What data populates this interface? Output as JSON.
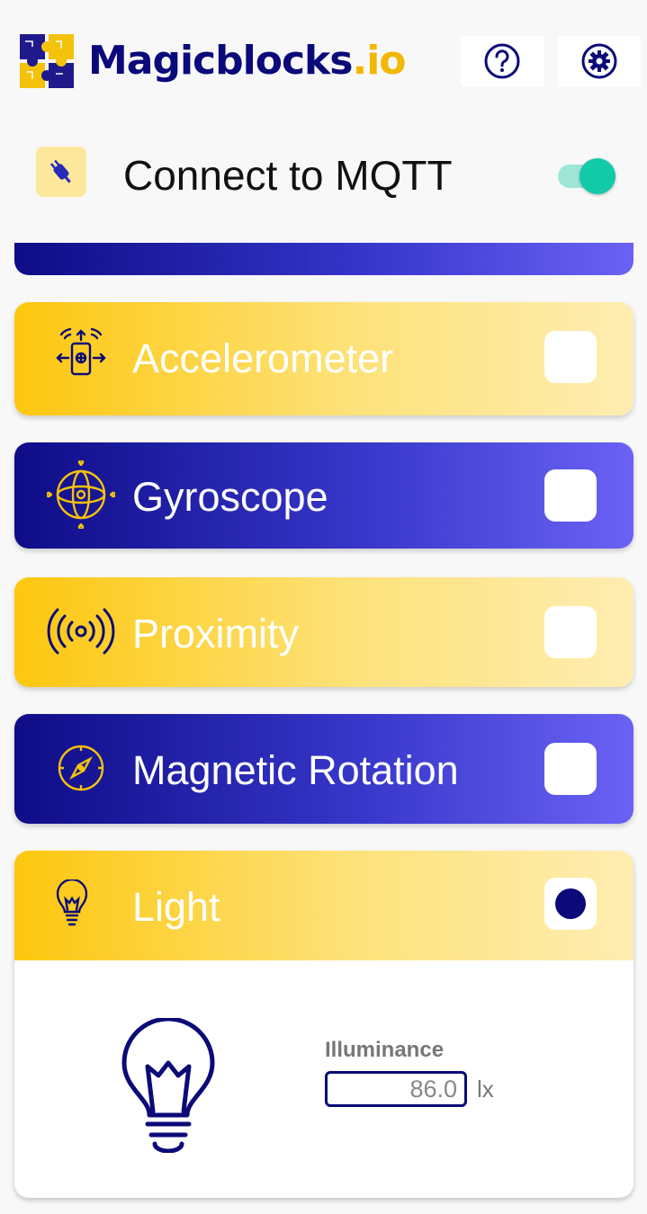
{
  "header": {
    "brand_main": "Magicblocks",
    "brand_tld": ".io",
    "help_icon": "question-circle-icon",
    "settings_icon": "gear-icon"
  },
  "mqtt": {
    "label": "Connect to MQTT",
    "enabled": true,
    "icon": "plug-icon"
  },
  "sensors": [
    {
      "label": "Accelerometer",
      "icon": "phone-motion-icon",
      "checked": false,
      "style": "yellow"
    },
    {
      "label": "Gyroscope",
      "icon": "gyroscope-icon",
      "checked": false,
      "style": "blue"
    },
    {
      "label": "Proximity",
      "icon": "proximity-waves-icon",
      "checked": false,
      "style": "yellow"
    },
    {
      "label": "Magnetic Rotation",
      "icon": "compass-icon",
      "checked": false,
      "style": "blue"
    },
    {
      "label": "Light",
      "icon": "lightbulb-icon",
      "checked": true,
      "style": "yellow"
    }
  ],
  "light_panel": {
    "field_label": "Illuminance",
    "value": "86.0",
    "unit": "lx"
  },
  "colors": {
    "brand_navy": "#0b0a78",
    "brand_yellow": "#fdc70e",
    "toggle_on": "#12c9a8",
    "card_blue_end": "#6b62f5"
  }
}
